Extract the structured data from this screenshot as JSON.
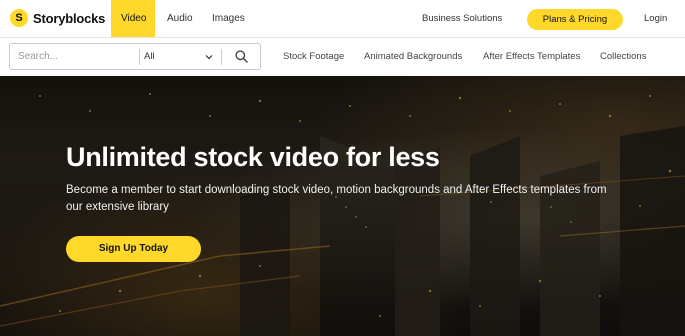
{
  "brand": {
    "name": "Storyblocks",
    "mark": "S"
  },
  "topnav": {
    "tabs": [
      {
        "label": "Video",
        "active": true
      },
      {
        "label": "Audio",
        "active": false
      },
      {
        "label": "Images",
        "active": false
      }
    ],
    "business": "Business Solutions",
    "plans": "Plans & Pricing",
    "login": "Login"
  },
  "search": {
    "placeholder": "Search...",
    "value": "",
    "category": "All"
  },
  "subnav": {
    "links": [
      "Stock Footage",
      "Animated Backgrounds",
      "After Effects Templates",
      "Collections"
    ]
  },
  "hero": {
    "title": "Unlimited stock video for less",
    "subtitle": "Become a member to start downloading stock video, motion backgrounds and After Effects templates from our extensive library",
    "cta": "Sign Up Today"
  },
  "colors": {
    "accent": "#ffd82a",
    "text_dark": "#111111"
  },
  "icons": {
    "search": "search-icon",
    "chevron": "chevron-down-icon",
    "logo": "storyblocks-logo-icon"
  }
}
